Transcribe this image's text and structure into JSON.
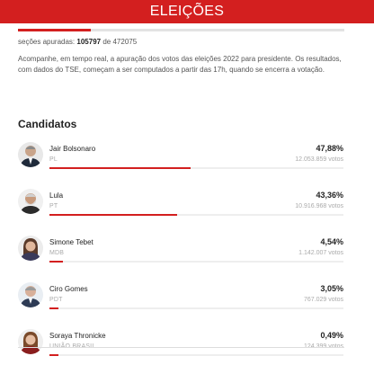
{
  "header": {
    "title": "ELEIÇÕES"
  },
  "progress": {
    "sections_fraction": 0.2242,
    "accent": "#d31f1f"
  },
  "sections": {
    "prefix": "seções apuradas:",
    "counted": "105797",
    "middle": "de",
    "total": "472075"
  },
  "intro": {
    "text": "Acompanhe, em tempo real, a apuração dos votos das eleições 2022 para presidente. Os resultados, com dados do TSE, começam a ser computados a partir das 17h, quando se encerra a votação."
  },
  "candidates_title": "Candidatos",
  "candidates": [
    {
      "name": "Jair Bolsonaro",
      "party": "PL",
      "percent": "47,88%",
      "votes": "12.053.859 votos",
      "share": 0.4788,
      "avatar": "bolsonaro"
    },
    {
      "name": "Lula",
      "party": "PT",
      "percent": "43,36%",
      "votes": "10.916.968 votos",
      "share": 0.4336,
      "avatar": "lula"
    },
    {
      "name": "Simone Tebet",
      "party": "MDB",
      "percent": "4,54%",
      "votes": "1.142.007 votos",
      "share": 0.0454,
      "avatar": "tebet"
    },
    {
      "name": "Ciro Gomes",
      "party": "PDT",
      "percent": "3,05%",
      "votes": "767.029 votos",
      "share": 0.0305,
      "avatar": "ciro"
    },
    {
      "name": "Soraya Thronicke",
      "party": "UNIÃO BRASIL",
      "percent": "0,49%",
      "votes": "124.399 votos",
      "share": 0.0049,
      "avatar": "soraya"
    }
  ]
}
